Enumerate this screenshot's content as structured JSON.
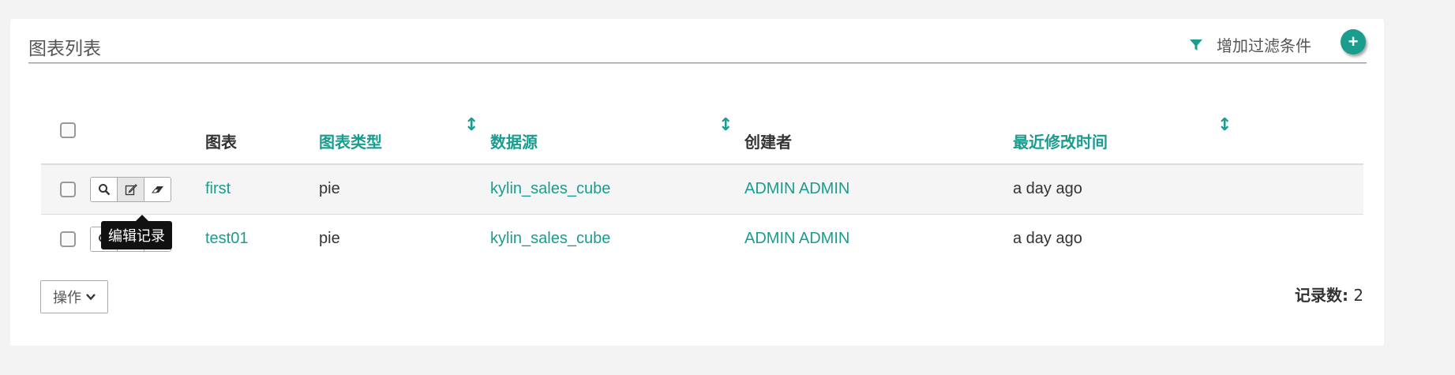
{
  "panel": {
    "title": "图表列表",
    "filter_label": "增加过滤条件",
    "add_button": "+"
  },
  "table": {
    "columns": [
      "图表",
      "图表类型",
      "数据源",
      "创建者",
      "最近修改时间"
    ],
    "rows": [
      {
        "chart": "first",
        "type": "pie",
        "datasource": "kylin_sales_cube",
        "creator": "ADMIN ADMIN",
        "modified": "a day ago"
      },
      {
        "chart": "test01",
        "type": "pie",
        "datasource": "kylin_sales_cube",
        "creator": "ADMIN ADMIN",
        "modified": "a day ago"
      }
    ]
  },
  "tooltip": "编辑记录",
  "footer": {
    "actions_label": "操作",
    "count_label": "记录数:",
    "count_value": "2"
  },
  "colors": {
    "accent": "#1a9c8e"
  },
  "icons": [
    "filter-icon",
    "plus-icon",
    "search-icon",
    "edit-icon",
    "eraser-icon",
    "sort-icon",
    "chevron-down-icon"
  ]
}
